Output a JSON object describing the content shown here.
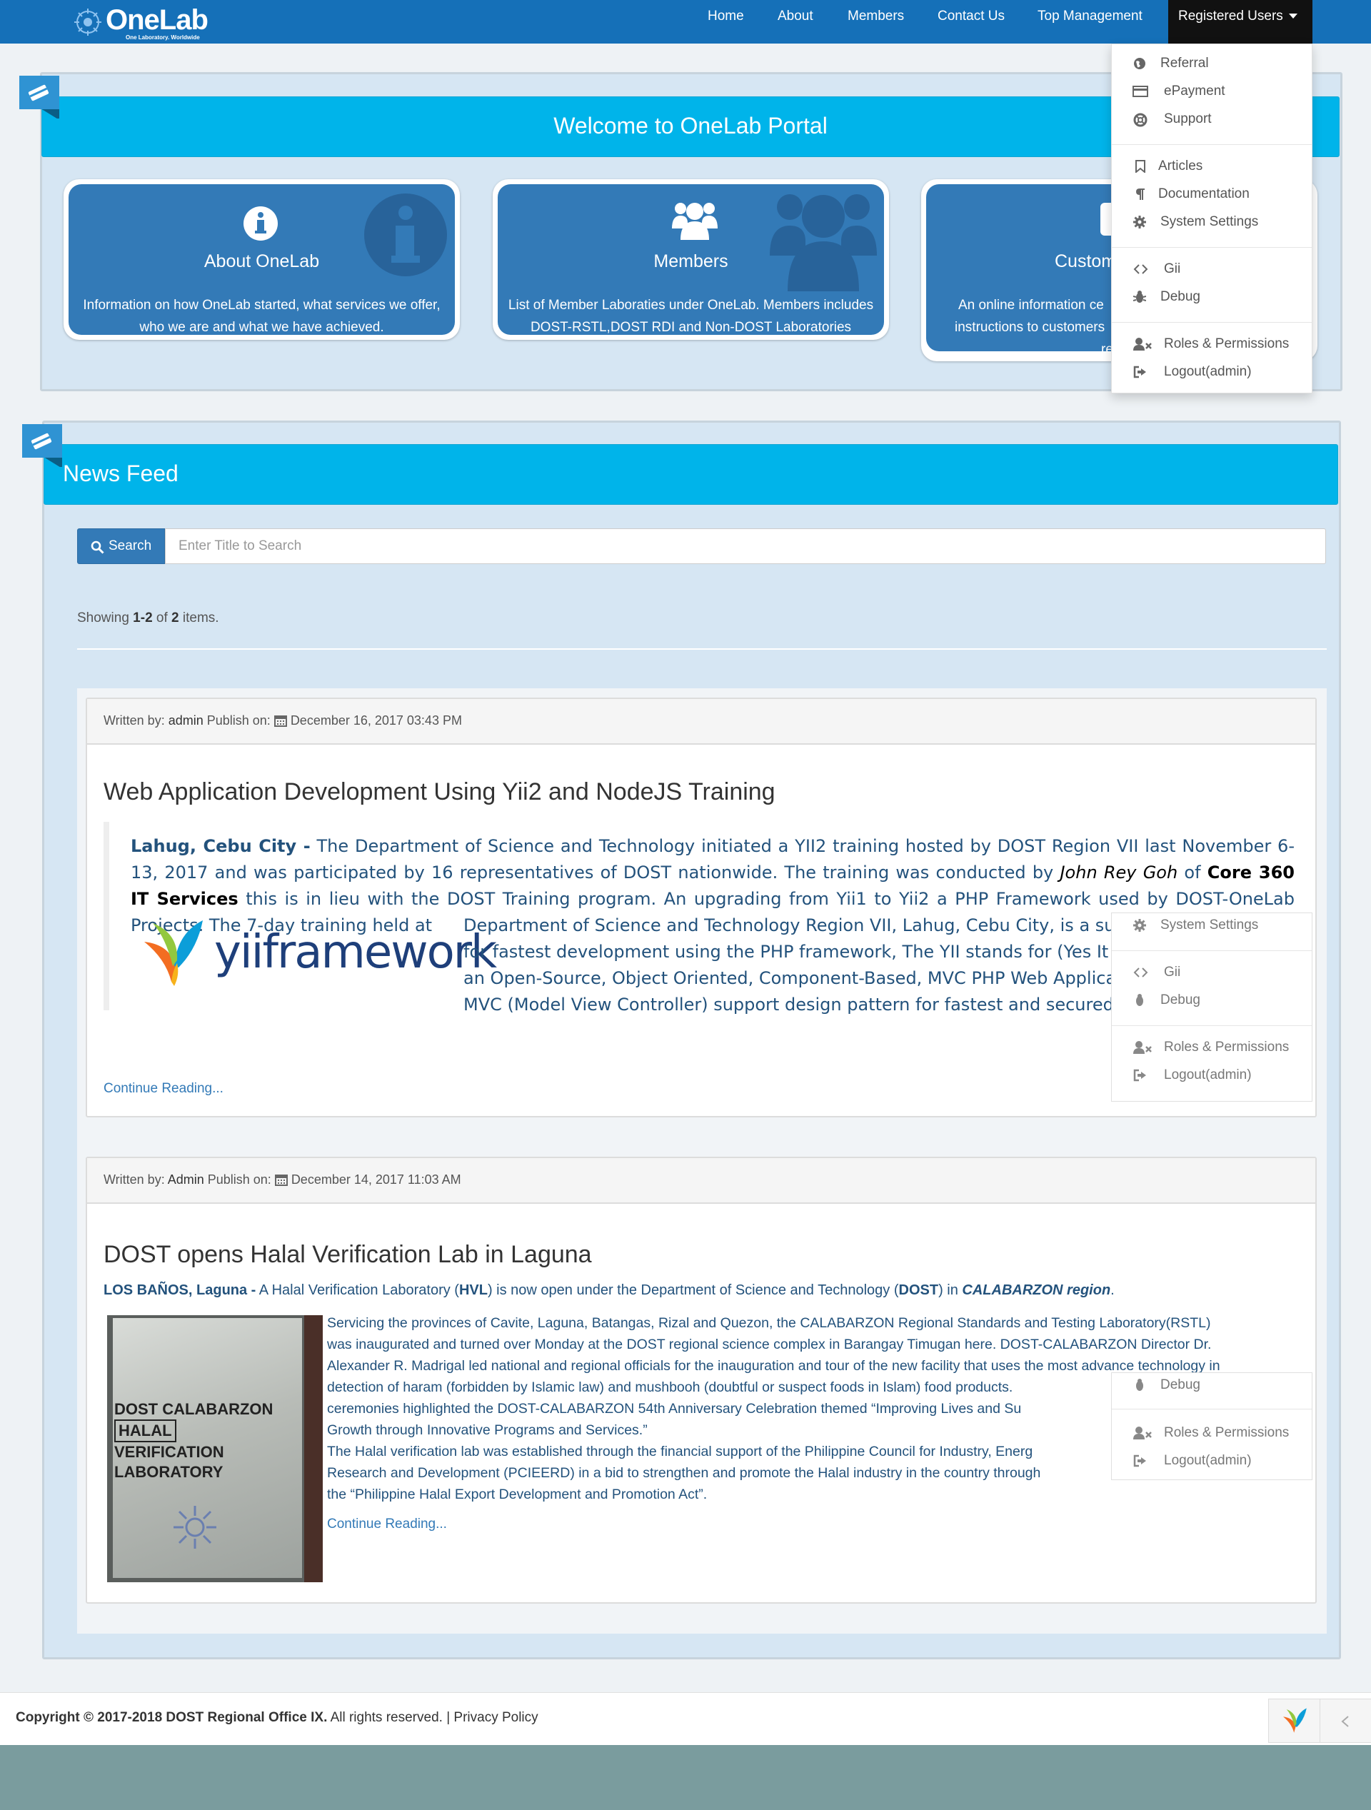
{
  "navbar": {
    "brand": "OneLab",
    "brand_tagline": "One Laboratory. Worldwide",
    "items": [
      "Home",
      "About",
      "Members",
      "Contact Us",
      "Top Management"
    ],
    "dropdown_toggle": "Registered Users",
    "dropdown_items": {
      "referral": "Referral",
      "epayment": "ePayment",
      "support": "Support",
      "articles": "Articles",
      "documentation": "Documentation",
      "system_settings": "System Settings",
      "gii": "Gii",
      "debug": "Debug",
      "roles": "Roles & Permissions",
      "logout": "Logout(admin)"
    }
  },
  "welcome": {
    "title": "Welcome to OneLab Portal",
    "cards": [
      {
        "title": "About OneLab",
        "desc": "Information on how OneLab started, what services we offer, who we are and what we have achieved.",
        "icon": "info-icon"
      },
      {
        "title": "Members",
        "desc": "List of Member Laboraties under OneLab. Members includes DOST-RSTL,DOST RDI and Non-DOST Laboratories",
        "icon": "users-icon"
      },
      {
        "title": "Custom",
        "desc": "An online information ce",
        "desc2": "instructions to customers",
        "desc3": "requir",
        "icon": "customer-icon"
      }
    ]
  },
  "news": {
    "title": "News Feed",
    "search_button": "Search",
    "search_placeholder": "Enter Title to Search",
    "summary_prefix": "Showing ",
    "summary_range": "1-2",
    "summary_mid": " of ",
    "summary_total": "2",
    "summary_suffix": " items.",
    "written_by": "Written by: ",
    "publish_on": " Publish on: ",
    "articles": [
      {
        "author": "admin",
        "date": "December 16, 2017 03:43 PM",
        "title": "Web Application Development Using Yii2 and NodeJS Training",
        "location": "Lahug, Cebu City -",
        "p1_a": " The Department of Science and Technology initiated a YII2 training hosted by DOST Region VII last November 6-13, 2017 and was participated by 16 representatives of DOST nationwide. The training was conducted by ",
        "p1_person": "John Rey Goh",
        "p1_of": " of ",
        "p1_company": "Core 360 IT Services",
        "p1_b": " this is in lieu with the DOST Training program. An upgrading from Yii1 to Yii2  a PHP Framework  used by DOST-OneLab Projects. The  7-day training held at",
        "float_lines": [
          "Department of Science and Technology Region VII, Lahug, Cebu City, is a succes",
          "for fastest development using the PHP framework, The YII stands for (Yes It Is) four",
          "an Open-Source, Object Oriented, Component-Based, MVC PHP Web Application",
          "MVC (Model View Controller) support design pattern for fastest and secured web app"
        ],
        "image_text": "yiiframework",
        "continue": "Continue Reading..."
      },
      {
        "author": "Admin",
        "date": "December 14, 2017 11:03 AM",
        "title": "DOST opens Halal Verification Lab in Laguna",
        "lead_location": "LOS BAÑOS, Laguna -",
        "lead_a": " A Halal Verification Laboratory (",
        "lead_hvl": "HVL",
        "lead_b": ") is now open under the Department of Science and Technology (",
        "lead_dost": "DOST",
        "lead_c": ") in ",
        "lead_region": "CALABARZON region",
        "lead_d": ".",
        "body_lines": [
          "Servicing the provinces of Cavite, Laguna, Batangas, Rizal and Quezon, the CALABARZON Regional Standards and Testing Laboratory(RSTL)",
          "was inaugurated and turned over Monday at the DOST regional science complex in Barangay Timugan here. DOST-CALABARZON Director Dr.",
          "Alexander R. Madrigal led national and regional officials for the inauguration and tour of the new facility that uses the most advance technology in",
          "detection of haram (forbidden by Islamic law) and mushbooh (doubtful or suspect foods in Islam) food products. ",
          "ceremonies highlighted the DOST-CALABARZON 54th Anniversary Celebration themed “Improving Lives and Su",
          "Growth through Innovative Programs and Services.”",
          "The Halal verification lab was established through the financial support of the Philippine Council for Industry, Energ",
          "Research and Development (PCIEERD) in a bid to strengthen and promote the Halal industry in the country through",
          "the “Philippine Halal Export Development and Promotion Act”."
        ],
        "photo_lines": [
          "DOST CALABARZON",
          "HALAL",
          "VERIFICATION",
          "LABORATORY"
        ],
        "continue": "Continue Reading..."
      }
    ]
  },
  "footer": {
    "copyright": "Copyright © 2017-2018 ",
    "org": "DOST Regional Office IX.",
    "rights": " All rights reserved. | ",
    "privacy": "Privacy Policy"
  }
}
